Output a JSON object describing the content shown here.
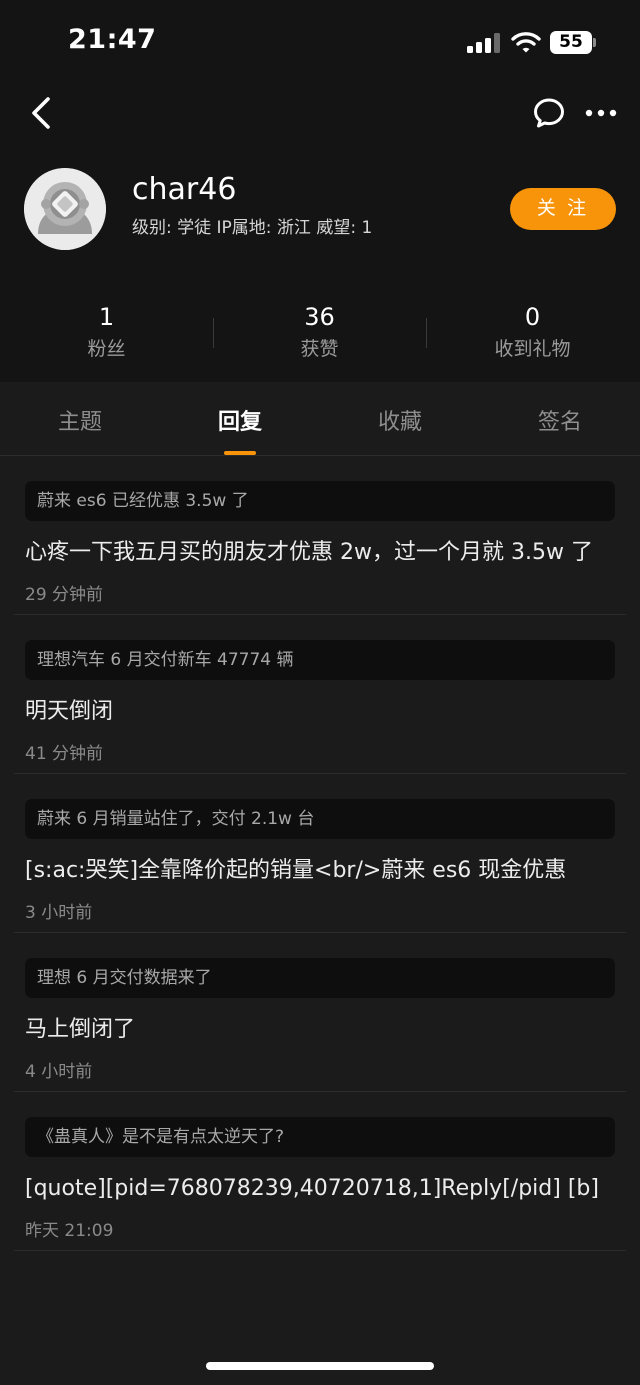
{
  "status_bar": {
    "time": "21:47",
    "battery": "55"
  },
  "profile": {
    "username": "char46",
    "meta": "级别: 学徒  IP属地: 浙江  威望: 1",
    "follow_label": "关 注"
  },
  "stats": [
    {
      "value": "1",
      "label": "粉丝"
    },
    {
      "value": "36",
      "label": "获赞"
    },
    {
      "value": "0",
      "label": "收到礼物"
    }
  ],
  "tabs": [
    {
      "label": "主题"
    },
    {
      "label": "回复",
      "active": true
    },
    {
      "label": "收藏"
    },
    {
      "label": "签名"
    }
  ],
  "replies": [
    {
      "topic": "蔚来 es6 已经优惠 3.5w 了",
      "content": "心疼一下我五月买的朋友才优惠 2w，过一个月就 3.5w 了",
      "time": "29 分钟前"
    },
    {
      "topic": "理想汽车 6 月交付新车 47774 辆",
      "content": "明天倒闭",
      "time": "41 分钟前"
    },
    {
      "topic": "蔚来 6 月销量站住了，交付 2.1w 台",
      "content": "[s:ac:哭笑]全靠降价起的销量<br/>蔚来 es6 现金优惠",
      "time": "3 小时前"
    },
    {
      "topic": "理想 6 月交付数据来了",
      "content": "马上倒闭了",
      "time": "4 小时前"
    },
    {
      "topic": "《蛊真人》是不是有点太逆天了?",
      "content": "[quote][pid=768078239,40720718,1]Reply[/pid] [b]",
      "time": "昨天 21:09"
    }
  ]
}
